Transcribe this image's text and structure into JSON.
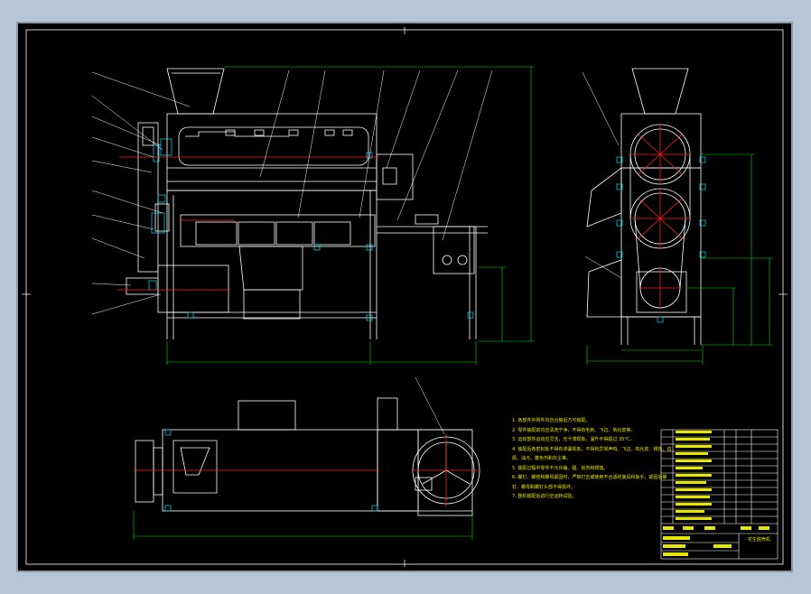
{
  "drawing": {
    "background_color": "#000000",
    "line_colors": {
      "outline": "#ffffff",
      "dimension": "#00e000",
      "centerline": "#ff2020",
      "leader": "#ffffff",
      "hatch": "#00e5ff",
      "text": "#e6e600",
      "frame": "#ffffff"
    },
    "views": [
      "front-view",
      "side-view",
      "top-view"
    ]
  },
  "tech_notes": [
    "1. 各部件外购件均应合格后方可装配。",
    "2. 零件装配前均应清洗干净，不得有毛刺、飞边、氧化皮等。",
    "3. 运动部件运动应灵活，无卡滞现象，温升不得超过 35℃。",
    "4. 装配后各密封处不得有渗漏现象，不得有异常声响、飞边、氧化皮、锈蚀、切",
    "屑、油污、着色剂和灰尘等。",
    "5. 装配过程中零件不允许磕、碰、划伤和锈蚀。",
    "6. 螺钉、螺栓和螺母紧固时，严禁打击或使用不合适的旋具和扳手，紧固后螺",
    "钉、螺母和螺钉头部不得损坏。",
    "7. 整机装配后进行空运转试验。"
  ],
  "title_block": {
    "drawing_title": "花生脱壳机"
  }
}
